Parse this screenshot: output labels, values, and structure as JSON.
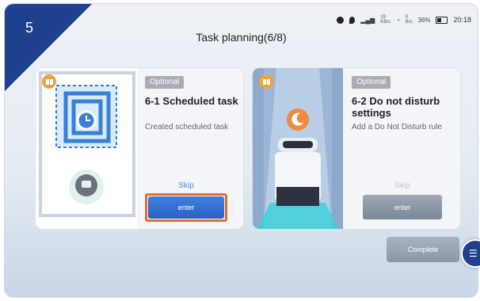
{
  "corner": {
    "step": "5",
    "color": "#1f3f8f"
  },
  "status_bar": {
    "icons": [
      "app-circle-icon",
      "location-icon",
      "signal-icon",
      "wifi-icon",
      "battery-icon"
    ],
    "signal_speed": "19",
    "signal_unit": "KB/s",
    "wifi_speed": "0",
    "wifi_unit": "B/s",
    "battery": "36%",
    "time": "20:18"
  },
  "title": "Task planning(6/8)",
  "cards": [
    {
      "badge_icon": "book-icon",
      "tag": "Optional",
      "title": "6-1  Scheduled task",
      "description": "Created scheduled task",
      "skip": "Skip",
      "enter": "enter",
      "highlighted": true
    },
    {
      "badge_icon": "book-icon",
      "tag": "Optional",
      "title": "6-2  Do not disturb settings",
      "description": "Add a Do Not Disturb rule",
      "skip": "Skip",
      "enter": "enter",
      "highlighted": false
    }
  ],
  "complete": "Complete",
  "colors": {
    "accent": "#2a62c4",
    "highlight": "#ef6a24",
    "badge": "#f2a23a",
    "disabled": "#8b97a8"
  }
}
